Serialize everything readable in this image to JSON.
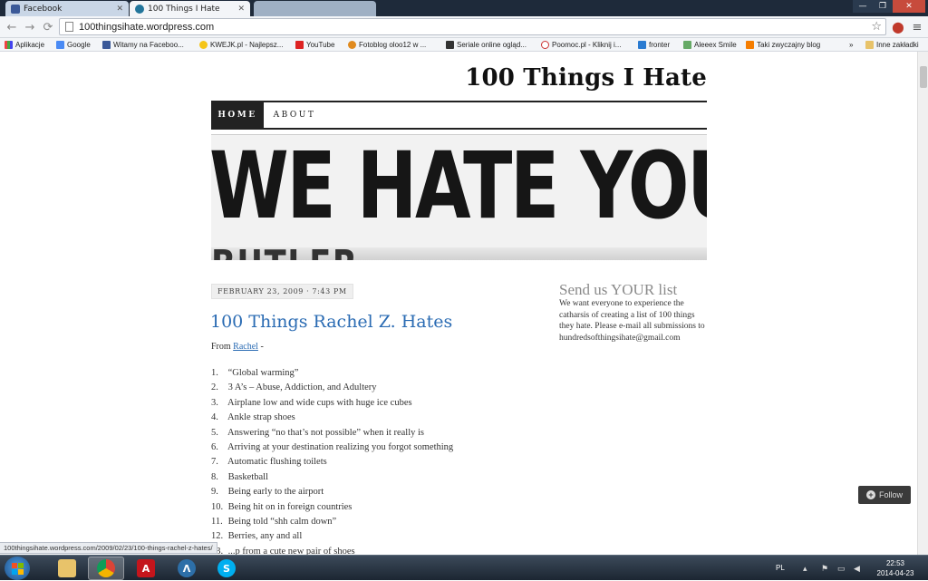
{
  "browser": {
    "tabs": [
      {
        "label": "Facebook",
        "state": "inactive"
      },
      {
        "label": "100 Things I Hate",
        "state": "active"
      },
      {
        "label": "",
        "state": "ghost"
      }
    ],
    "url": "100thingsihate.wordpress.com",
    "bookmarks": [
      {
        "label": "Aplikacje",
        "icon": "apps-grid-icon"
      },
      {
        "label": "Google",
        "icon": "google-icon"
      },
      {
        "label": "Witamy na Faceboo...",
        "icon": "facebook-icon"
      },
      {
        "label": "KWEJK.pl - Najlepsz...",
        "icon": "smiley-icon"
      },
      {
        "label": "YouTube",
        "icon": "youtube-icon"
      },
      {
        "label": "Fotoblog oloo12 w ...",
        "icon": "fotoblog-icon"
      },
      {
        "label": "Seriale online ogląd...",
        "icon": "seriale-icon"
      },
      {
        "label": "Poomoc.pl - Kliknij i...",
        "icon": "heart-icon"
      },
      {
        "label": "fronter",
        "icon": "fronter-icon"
      },
      {
        "label": "Aleeex Smile",
        "icon": "aleeex-icon"
      },
      {
        "label": "Taki zwyczajny blog",
        "icon": "blogger-icon"
      },
      {
        "label": "»",
        "icon": ""
      },
      {
        "label": "Inne zakładki",
        "icon": "folder-icon"
      }
    ],
    "status_url": "100thingsihate.wordpress.com/2009/02/23/100-things-rachel-z-hates/"
  },
  "site": {
    "title": "100 Things I Hate",
    "nav": [
      {
        "label": "HOME"
      },
      {
        "label": "ABOUT"
      }
    ],
    "header_image_text": "WE HATE YOU",
    "header_image_fragment": "BUTLER"
  },
  "post": {
    "date": "FEBRUARY 23, 2009 · 7:43 PM",
    "title": "100 Things Rachel Z. Hates",
    "from_prefix": "From",
    "from_author": "Rachel",
    "from_suffix": "-",
    "items": [
      {
        "num": "1.",
        "text": "“Global warming”"
      },
      {
        "num": "2.",
        "text": "3 A’s – Abuse, Addiction, and Adultery"
      },
      {
        "num": "3.",
        "text": "Airplane low and wide cups with huge ice cubes"
      },
      {
        "num": "4.",
        "text": "Ankle strap shoes"
      },
      {
        "num": "5.",
        "text": "Answering “no that’s not possible” when it really is"
      },
      {
        "num": "6.",
        "text": "Arriving at your destination realizing you forgot something"
      },
      {
        "num": "7.",
        "text": "Automatic flushing toilets"
      },
      {
        "num": "8.",
        "text": "Basketball"
      },
      {
        "num": "9.",
        "text": "Being early to the airport"
      },
      {
        "num": "10.",
        "text": "Being hit on in foreign countries"
      },
      {
        "num": "11.",
        "text": "Being told “shh calm down”"
      },
      {
        "num": "12.",
        "text": "Berries, any and all"
      },
      {
        "num": "13.",
        "text": "...p from a cute new pair of shoes"
      }
    ]
  },
  "sidebar": {
    "title": "Send us YOUR list",
    "text": "We want everyone to experience the catharsis of creating a list of 100 things they hate. Please e-mail all submissions to hundredsofthingsihate@gmail.com"
  },
  "follow_label": "Follow",
  "taskbar": {
    "apps": [
      {
        "name": "explorer",
        "icon": "folder-icon"
      },
      {
        "name": "chrome",
        "icon": "chrome-icon"
      },
      {
        "name": "acrobat",
        "icon": "acrobat-icon"
      },
      {
        "name": "app-a",
        "icon": "triangle-a-icon"
      },
      {
        "name": "skype",
        "icon": "skype-icon"
      }
    ],
    "language": "PL",
    "time": "22:53",
    "date": "2014-04-23"
  },
  "colors": {
    "link": "#2a6bb3",
    "nav_active_bg": "#222222",
    "sidebar_title": "#8a8a8a"
  }
}
